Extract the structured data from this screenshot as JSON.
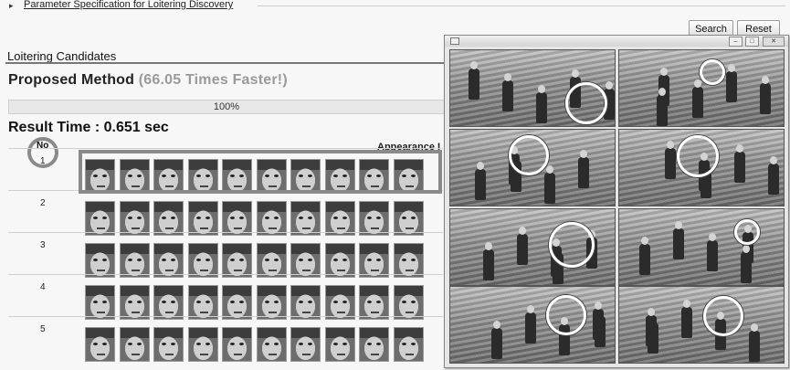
{
  "header": {
    "param_spec_link": "Parameter Specification for Loitering Discovery",
    "search_label": "Search",
    "reset_label": "Reset"
  },
  "candidates": {
    "section_title": "Loitering Candidates",
    "method_label": "Proposed Method",
    "speedup_label": "(66.05 Times Faster!)",
    "progress_text": "100%",
    "progress_value": 1.0,
    "result_time": "Result Time : 0.651 sec",
    "col_no": "No",
    "col_appearance": "Appearance I",
    "rows": [
      {
        "no": "1",
        "faces": 10
      },
      {
        "no": "2",
        "faces": 10
      },
      {
        "no": "3",
        "faces": 10
      },
      {
        "no": "4",
        "faces": 10
      },
      {
        "no": "5",
        "faces": 10
      }
    ]
  },
  "popup": {
    "window_buttons": [
      "minimize-icon",
      "maximize-icon",
      "close-icon"
    ],
    "scenes": [
      "scene-1",
      "scene-2",
      "scene-3",
      "scene-4",
      "scene-5",
      "scene-6",
      "scene-7",
      "scene-8"
    ]
  }
}
